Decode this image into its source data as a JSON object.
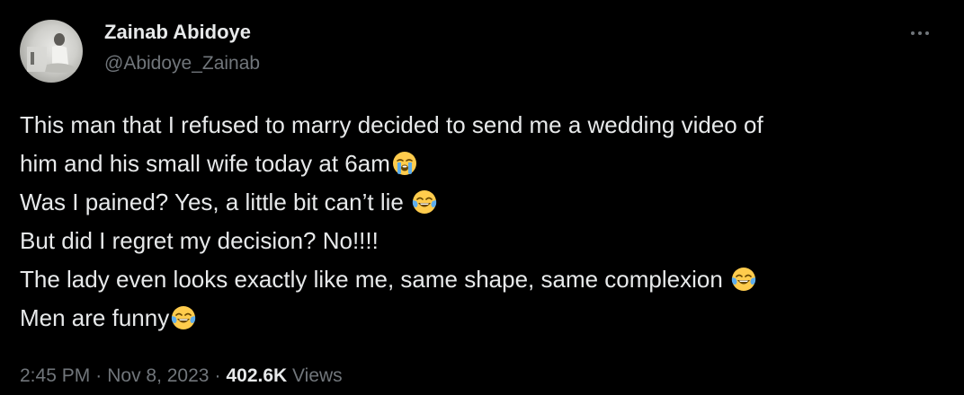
{
  "author": {
    "display_name": "Zainab Abidoye",
    "handle": "@Abidoye_Zainab"
  },
  "more_icon": "ellipsis-icon",
  "tweet": {
    "lines": [
      "This man that I refused to marry decided to send me a wedding video of",
      "him and his small wife today at 6am",
      "Was I pained? Yes, a little bit can’t lie ",
      "But did I regret my decision? No!!!!",
      "The lady even looks exactly like me, same shape, same complexion ",
      "Men are funny"
    ],
    "emojis": {
      "line2": "loudly-crying-face-emoji",
      "line3": "face-with-tears-of-joy-emoji",
      "line5": "face-with-tears-of-joy-emoji",
      "line6": "face-with-tears-of-joy-emoji"
    }
  },
  "meta": {
    "time": "2:45 PM",
    "separator": "·",
    "date": "Nov 8, 2023",
    "views_count": "402.6K",
    "views_label": "Views"
  },
  "colors": {
    "background": "#000000",
    "primary_text": "#e7e9ea",
    "secondary_text": "#71767b"
  }
}
